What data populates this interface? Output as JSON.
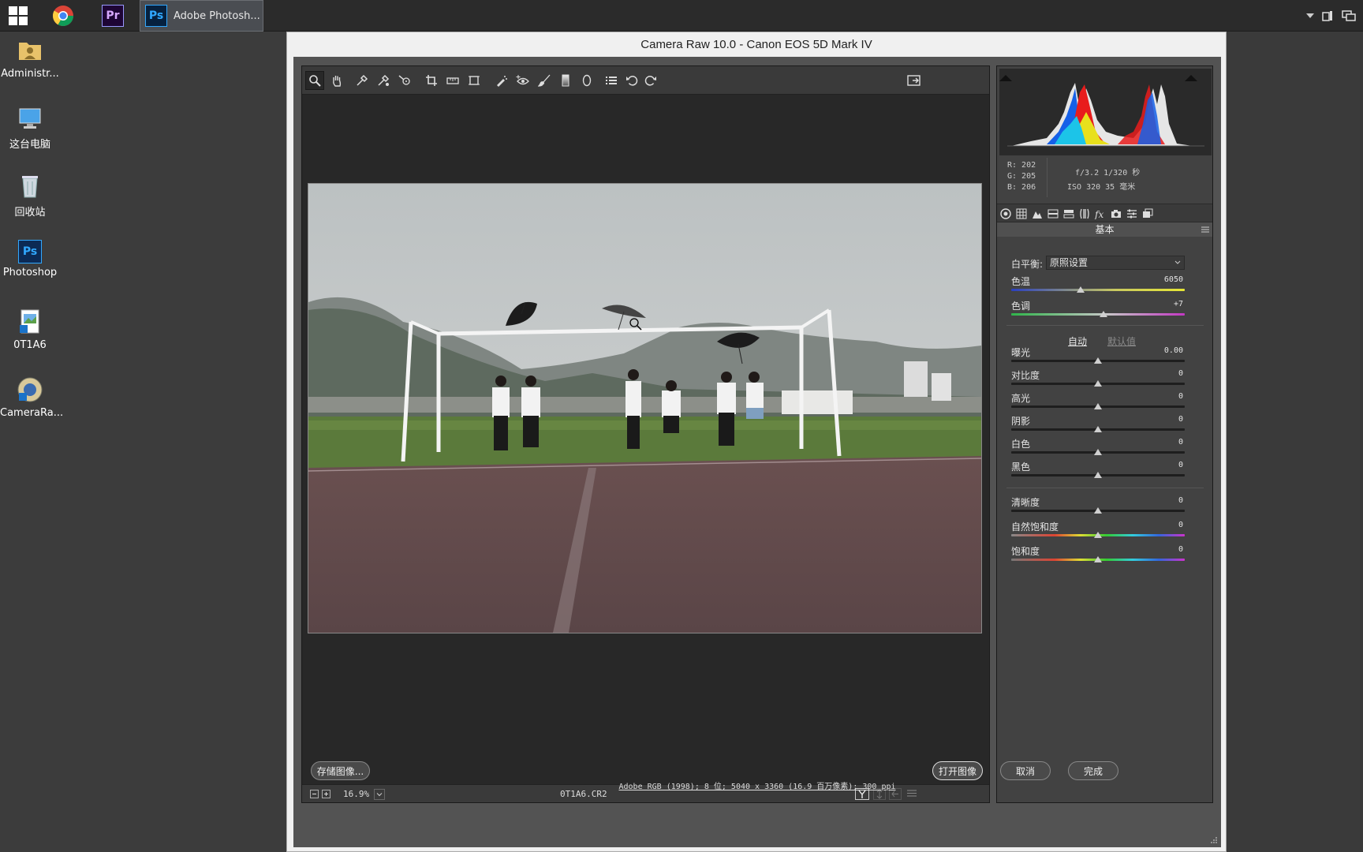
{
  "taskbar": {
    "active_app_label": "Adobe Photosh...",
    "pr_tile": "Pr",
    "ps_tile": "Ps"
  },
  "desktop": {
    "icons": [
      {
        "label": "Administr...",
        "icon": "user-folder-icon"
      },
      {
        "label": "这台电脑",
        "icon": "computer-icon"
      },
      {
        "label": "回收站",
        "icon": "recycle-bin-icon"
      },
      {
        "label": "Photoshop",
        "icon": "photoshop-file-icon"
      },
      {
        "label": "0T1A6",
        "icon": "image-file-icon"
      },
      {
        "label": "CameraRa...",
        "icon": "camera-raw-icon"
      }
    ],
    "ps_icon_text": "Ps"
  },
  "dialog": {
    "title": "Camera Raw 10.0 -  Canon EOS 5D Mark IV"
  },
  "preview": {
    "zoom": "16.9%",
    "filename": "0T1A6.CR2"
  },
  "histogram": {
    "r": "R:  202",
    "g": "G:  205",
    "b": "B:  206",
    "aperture_shutter": "f/3.2   1/320 秒",
    "iso_focal": "ISO 320   35 毫米"
  },
  "basic": {
    "section_title": "基本",
    "wb_label": "白平衡:",
    "wb_value": "原照设置",
    "auto": "自动",
    "default": "默认值",
    "sliders": [
      {
        "label": "色温",
        "value": "6050",
        "pos": 0.4
      },
      {
        "label": "色调",
        "value": "+7",
        "pos": 0.53
      },
      {
        "label": "曝光",
        "value": "0.00",
        "pos": 0.5
      },
      {
        "label": "对比度",
        "value": "0",
        "pos": 0.5
      },
      {
        "label": "高光",
        "value": "0",
        "pos": 0.5
      },
      {
        "label": "阴影",
        "value": "0",
        "pos": 0.5
      },
      {
        "label": "白色",
        "value": "0",
        "pos": 0.5
      },
      {
        "label": "黑色",
        "value": "0",
        "pos": 0.5
      },
      {
        "label": "清晰度",
        "value": "0",
        "pos": 0.5
      },
      {
        "label": "自然饱和度",
        "value": "0",
        "pos": 0.5
      },
      {
        "label": "饱和度",
        "value": "0",
        "pos": 0.5
      }
    ]
  },
  "footer": {
    "save": "存储图像...",
    "info": "Adobe RGB (1998); 8 位; 5040 x 3360 (16.9 百万像素); 300 ppi",
    "open": "打开图像",
    "cancel": "取消",
    "done": "完成"
  },
  "colors": {
    "panel": "#535353",
    "preview_bg": "#282828",
    "accent_ps": "#31a8ff"
  }
}
